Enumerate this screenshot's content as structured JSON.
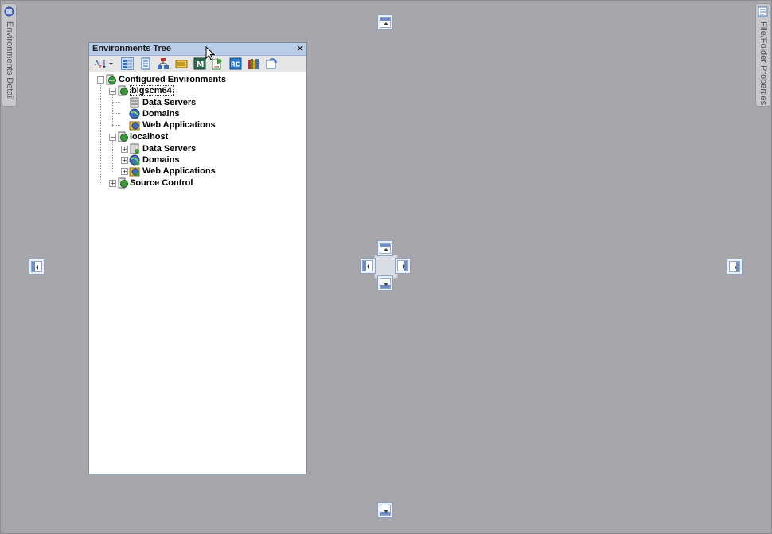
{
  "left_tab": {
    "label": "Environments Detail",
    "icon": "environment-icon"
  },
  "right_tab": {
    "label": "File/Folder Properties",
    "icon": "properties-icon"
  },
  "panel": {
    "title": "Environments Tree",
    "close_label": "✕",
    "toolbar": [
      {
        "name": "sort-icon"
      },
      {
        "name": "tree-view-icon",
        "active": true
      },
      {
        "name": "list-view-icon"
      },
      {
        "name": "hierarchy-icon"
      },
      {
        "name": "data-server-icon"
      },
      {
        "name": "m-icon"
      },
      {
        "name": "export-icon"
      },
      {
        "name": "rc-icon"
      },
      {
        "name": "books-icon"
      },
      {
        "name": "refresh-icon"
      }
    ],
    "tree": {
      "root": "Configured Environments",
      "env1": {
        "name": "bigscm64",
        "children": [
          "Data Servers",
          "Domains",
          "Web Applications"
        ]
      },
      "env2": {
        "name": "localhost",
        "children": [
          "Data Servers",
          "Domains",
          "Web Applications"
        ]
      },
      "source_control": "Source Control"
    }
  },
  "colors": {
    "background": "#a7a6aa",
    "title_bar": "#b9cde6",
    "dock_accent": "#6e8cc7"
  }
}
